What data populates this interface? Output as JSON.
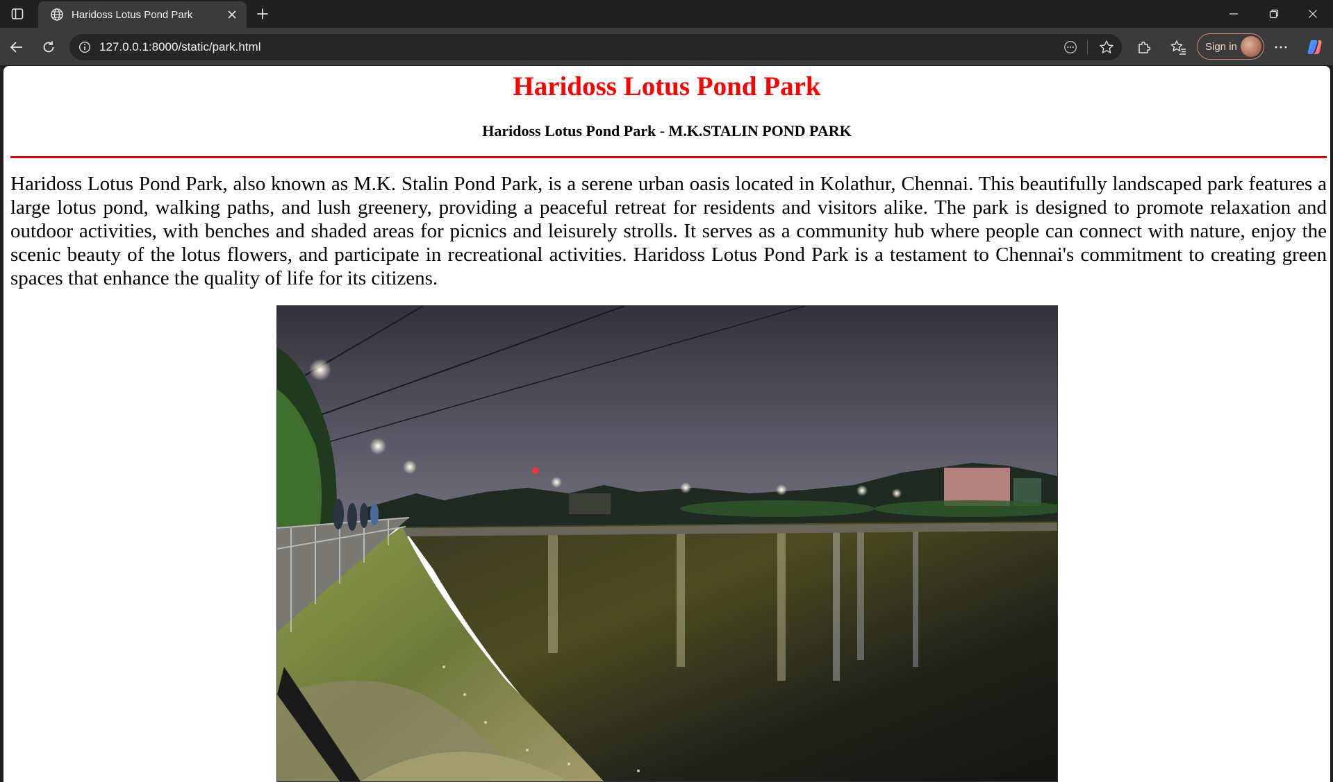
{
  "browser": {
    "tab": {
      "title": "Haridoss Lotus Pond Park",
      "favicon": "globe-icon"
    },
    "address_bar": {
      "url": "127.0.0.1:8000/static/park.html"
    },
    "sign_in_label": "Sign in"
  },
  "page": {
    "heading": "Haridoss Lotus Pond Park",
    "subheading": "Haridoss Lotus Pond Park - M.K.STALIN POND PARK",
    "description": "Haridoss Lotus Pond Park, also known as M.K. Stalin Pond Park, is a serene urban oasis located in Kolathur, Chennai. This beautifully landscaped park features a large lotus pond, walking paths, and lush greenery, providing a peaceful retreat for residents and visitors alike. The park is designed to promote relaxation and outdoor activities, with benches and shaded areas for picnics and leisurely strolls. It serves as a community hub where people can connect with nature, enjoy the scenic beauty of the lotus flowers, and participate in recreational activities. Haridoss Lotus Pond Park is a testament to Chennai's commitment to creating green spaces that enhance the quality of life for its citizens.",
    "colors": {
      "heading": "#ff0000",
      "rule": "#ee0000"
    }
  }
}
